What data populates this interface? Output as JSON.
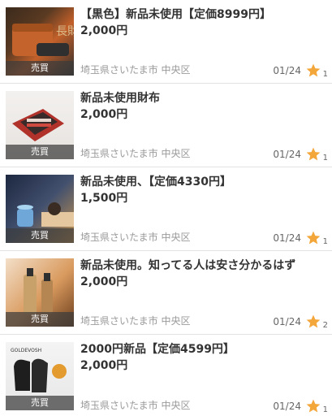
{
  "items": [
    {
      "title": "【黒色】新品未使用【定価8999円】",
      "price": "2,000円",
      "location": "埼玉県さいたま市 中央区",
      "date": "01/24",
      "likes": "1",
      "sold": "売買"
    },
    {
      "title": "新品未使用財布",
      "price": "2,000円",
      "location": "埼玉県さいたま市 中央区",
      "date": "01/24",
      "likes": "1",
      "sold": "売買"
    },
    {
      "title": "新品未使用、【定価4330円】",
      "price": "1,500円",
      "location": "埼玉県さいたま市 中央区",
      "date": "01/24",
      "likes": "1",
      "sold": "売買"
    },
    {
      "title": "新品未使用。知ってる人は安さ分かるはず",
      "price": "2,000円",
      "location": "埼玉県さいたま市 中央区",
      "date": "01/24",
      "likes": "2",
      "sold": "売買"
    },
    {
      "title": "2000円新品【定価4599円】",
      "price": "2,000円",
      "location": "埼玉県さいたま市 中央区",
      "date": "01/24",
      "likes": "1",
      "sold": "売買"
    }
  ],
  "thumb_text": {
    "item1": "長財布",
    "item5": "GOLDEVOSH"
  },
  "colors": {
    "star": "#f3a63a",
    "divider": "#e2e2e2",
    "location": "#9a9a9a"
  },
  "icons": {
    "favorite": "star-icon"
  }
}
